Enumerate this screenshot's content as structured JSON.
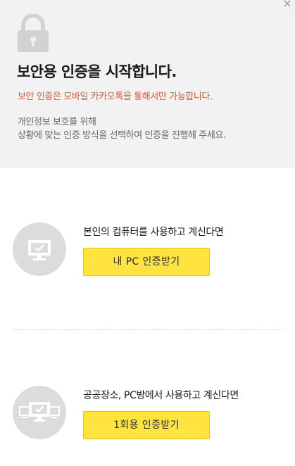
{
  "header": {
    "title": "보안용 인증을 시작합니다.",
    "warning": "보안 인증은 모바일 카카오톡을 통해서만 가능합니다.",
    "description_line1": "개인정보 보호를 위해",
    "description_line2": "상황에 맞는 인증 방식을 선택하여 인증을 진행해 주세요.",
    "close_glyph": "×"
  },
  "options": [
    {
      "label": "본인의 컴퓨터를 사용하고 계신다면",
      "button": "내 PC 인증받기",
      "icon": "monitor-check-icon"
    },
    {
      "label": "공공장소, PC방에서 사용하고 계신다면",
      "button": "1회용 인증받기",
      "icon": "shared-monitors-icon"
    }
  ],
  "colors": {
    "header_bg": "#f2f2f2",
    "warning": "#e05a37",
    "button_bg": "#ffe33f",
    "icon_circle": "#dcdcdc"
  }
}
